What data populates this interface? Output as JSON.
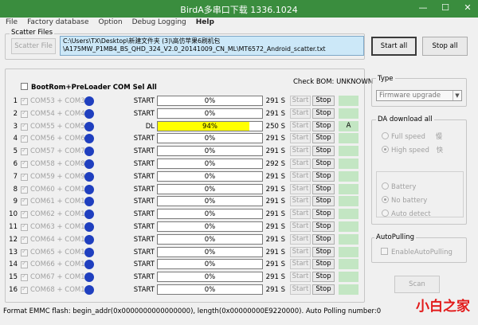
{
  "window": {
    "title": "BirdA多串口下载 1336.1024"
  },
  "menu": [
    "File",
    "Factory database",
    "Option",
    "Debug Logging",
    "Help"
  ],
  "scatter": {
    "group_label": "Scatter Files",
    "button": "Scatter File",
    "path_line1": "C:\\Users\\TX\\Desktop\\新建文件夹 (3)\\高仿苹果6刷机包",
    "path_line2": "\\A175MW_P1MB4_BS_QHD_324_V2.0_20141009_CN_ML\\MT6572_Android_scatter.txt"
  },
  "toolbar": {
    "start_all": "Start all",
    "stop_all": "Stop all"
  },
  "ports": {
    "sel_all_label": "BootRom+PreLoader COM Sel All",
    "check_bom": "Check BOM: UNKNOWN",
    "start_label": "Start",
    "stop_label": "Stop",
    "rows": [
      {
        "num": "1",
        "com": "COM53 + COM3",
        "status": "START",
        "percent": "0%",
        "progress": 0,
        "time": "291 S",
        "flag": ""
      },
      {
        "num": "2",
        "com": "COM54 + COM4",
        "status": "START",
        "percent": "0%",
        "progress": 0,
        "time": "291 S",
        "flag": ""
      },
      {
        "num": "3",
        "com": "COM55 + COM5",
        "status": "DL",
        "percent": "94%",
        "progress": 94,
        "time": "250 S",
        "flag": "A"
      },
      {
        "num": "4",
        "com": "COM56 + COM6",
        "status": "START",
        "percent": "0%",
        "progress": 0,
        "time": "291 S",
        "flag": ""
      },
      {
        "num": "5",
        "com": "COM57 + COM7",
        "status": "START",
        "percent": "0%",
        "progress": 0,
        "time": "291 S",
        "flag": ""
      },
      {
        "num": "6",
        "com": "COM58 + COM8",
        "status": "START",
        "percent": "0%",
        "progress": 0,
        "time": "292 S",
        "flag": ""
      },
      {
        "num": "7",
        "com": "COM59 + COM9",
        "status": "START",
        "percent": "0%",
        "progress": 0,
        "time": "291 S",
        "flag": ""
      },
      {
        "num": "8",
        "com": "COM60 + COM10",
        "status": "START",
        "percent": "0%",
        "progress": 0,
        "time": "291 S",
        "flag": ""
      },
      {
        "num": "9",
        "com": "COM61 + COM11",
        "status": "START",
        "percent": "0%",
        "progress": 0,
        "time": "291 S",
        "flag": ""
      },
      {
        "num": "10",
        "com": "COM62 + COM12",
        "status": "START",
        "percent": "0%",
        "progress": 0,
        "time": "291 S",
        "flag": ""
      },
      {
        "num": "11",
        "com": "COM63 + COM13",
        "status": "START",
        "percent": "0%",
        "progress": 0,
        "time": "291 S",
        "flag": ""
      },
      {
        "num": "12",
        "com": "COM64 + COM14",
        "status": "START",
        "percent": "0%",
        "progress": 0,
        "time": "291 S",
        "flag": ""
      },
      {
        "num": "13",
        "com": "COM65 + COM15",
        "status": "START",
        "percent": "0%",
        "progress": 0,
        "time": "291 S",
        "flag": ""
      },
      {
        "num": "14",
        "com": "COM66 + COM16",
        "status": "START",
        "percent": "0%",
        "progress": 0,
        "time": "291 S",
        "flag": ""
      },
      {
        "num": "15",
        "com": "COM67 + COM17",
        "status": "START",
        "percent": "0%",
        "progress": 0,
        "time": "291 S",
        "flag": ""
      },
      {
        "num": "16",
        "com": "COM68 + COM18",
        "status": "START",
        "percent": "0%",
        "progress": 0,
        "time": "291 S",
        "flag": ""
      }
    ]
  },
  "type_panel": {
    "label": "Type",
    "selected": "Firmware upgrade"
  },
  "da_panel": {
    "label": "DA download all",
    "full_speed": "Full speed",
    "full_speed_cn": "慢",
    "high_speed": "High speed",
    "high_speed_cn": "快",
    "battery": "Battery",
    "no_battery": "No battery",
    "auto_detect": "Auto detect"
  },
  "autopulling": {
    "label": "AutoPulling",
    "checkbox": "EnableAutoPulling"
  },
  "scan_button": "Scan",
  "statusbar": "Format EMMC flash:  begin_addr(0x0000000000000000), length(0x00000000E9220000). Auto Polling number:0",
  "watermark": "小白之家",
  "colors": {
    "titlebar": "#3a8d3e",
    "progress_fill": "#ffff00",
    "com_dot": "#1f3fbf",
    "indicator": "#c3e6c3",
    "path_bg": "#cce8f8"
  }
}
